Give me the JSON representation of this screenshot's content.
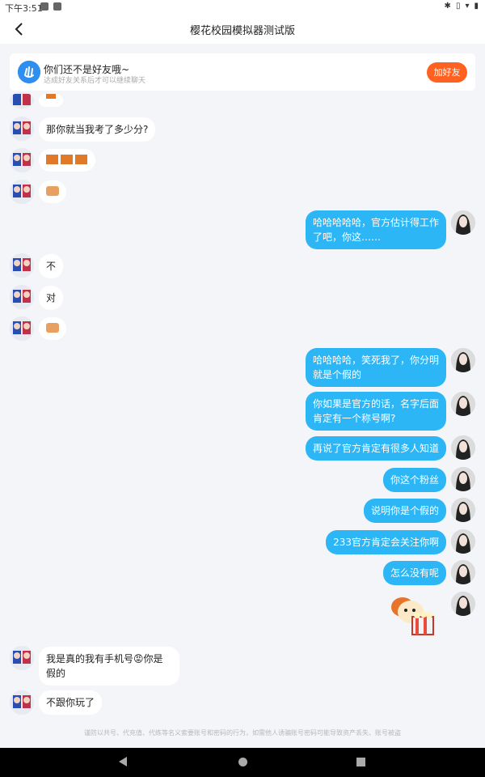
{
  "status_bar": {
    "time": "下午3:51"
  },
  "header": {
    "title": "樱花校园模拟器测试版"
  },
  "banner": {
    "title": "你们还不是好友哦~",
    "subtitle": "达成好友关系后才可以继续聊天",
    "button_label": "加好友"
  },
  "messages": {
    "m1": "那你就当我考了多少分?",
    "m2": "哈哈哈哈哈，官方估计得工作了吧，你这……",
    "m3": "不",
    "m4": "对",
    "m5": "哈哈哈哈，笑死我了，你分明就是个假的",
    "m6": "你如果是官方的话，名字后面肯定有一个称号啊?",
    "m7": "再说了官方肯定有很多人知道",
    "m8": "你这个粉丝",
    "m9": "说明你是个假的",
    "m10": "233官方肯定会关注你啊",
    "m11": "怎么没有呢",
    "m12": "我是真的我有手机号😡你是假的",
    "m13": "不跟你玩了"
  },
  "disclaimer": "谨防以共号、代充值、代练等名义索要账号和密码的行为，如需他人诱骗账号密码可能导致资产丢失、账号被盗",
  "colors": {
    "accent": "#2cb6f6",
    "button": "#ff6120"
  }
}
